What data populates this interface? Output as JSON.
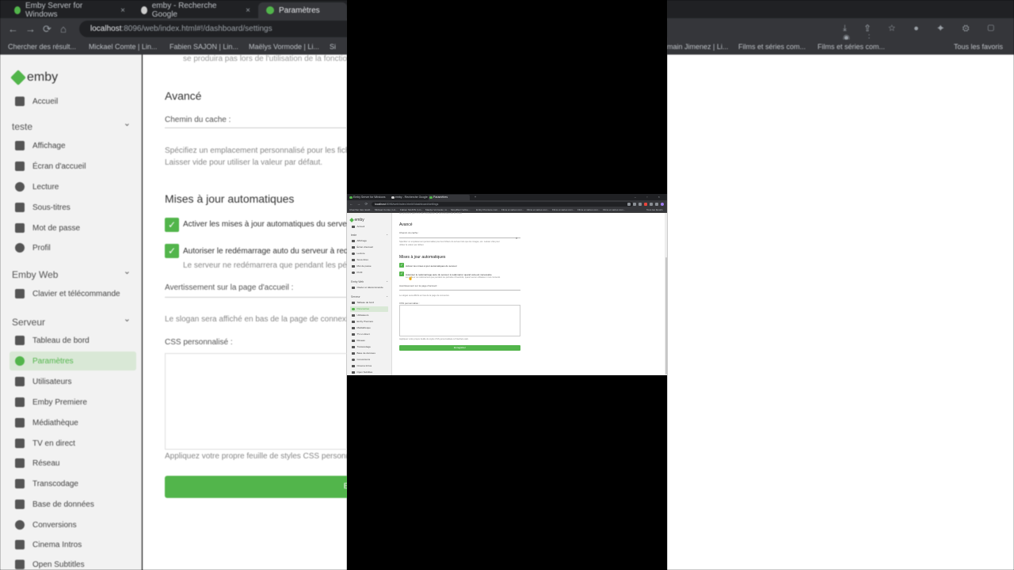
{
  "background": {
    "tabs": [
      {
        "label": "Emby Server for Windows",
        "close": "×"
      },
      {
        "label": "emby - Recherche Google",
        "close": "×"
      },
      {
        "label": "Paramètres",
        "close": "×"
      }
    ],
    "url_host": "localhost",
    "url_rest": ":8096/web/index.html#!/dashboard/settings",
    "bookmarks": [
      "Chercher des résult...",
      "Mickael Comte | Lin...",
      "Fabien SAJON | Lin...",
      "Maëlys Vormode | Li...",
      "Si"
    ],
    "bookmarks_right": [
      "main Jimenez | Li...",
      "Films et séries com...",
      "Films et séries com...",
      "Tous les favoris"
    ],
    "sidebar": {
      "logo": "emby",
      "home": "Accueil",
      "user_section": "teste",
      "user_items": [
        "Affichage",
        "Écran d'accueil",
        "Lecture",
        "Sous-titres",
        "Mot de passe",
        "Profil"
      ],
      "web_section": "Emby Web",
      "web_items": [
        "Clavier et télécommande"
      ],
      "server_section": "Serveur",
      "server_items": [
        "Tableau de bord",
        "Paramètres",
        "Utilisateurs",
        "Emby Premiere",
        "Médiathèque",
        "TV en direct",
        "Réseau",
        "Transcodage",
        "Base de données",
        "Conversions",
        "Cinema Intros",
        "Open Subtitles"
      ]
    },
    "main": {
      "faded_top": "se produira pas lors de l'utilisation de la fonction",
      "advanced_title": "Avancé",
      "cache_label": "Chemin du cache :",
      "cache_hint_1": "Spécifiez un emplacement personnalisé pour les fichi",
      "cache_hint_2": "Laisser vide pour utiliser la valeur par défaut.",
      "updates_title": "Mises à jour automatiques",
      "check1": "Activer les mises à jour automatiques du serveu",
      "check2": "Autoriser le redémarrage auto du serveur à redé",
      "check2_hint": "Le serveur ne redémarrera que pendant les pério",
      "warning_label": "Avertissement sur la page d'accueil :",
      "warning_hint": "Le slogan sera affiché en bas de la page de connexio",
      "css_label": "CSS personnalisé :",
      "css_hint": "Appliquez votre propre feuille de styles CSS personna",
      "save_partial": "En"
    }
  },
  "window": {
    "tabs": [
      {
        "label": "Emby Server for Windows",
        "close": "×"
      },
      {
        "label": "emby - Recherche Google",
        "close": "×"
      },
      {
        "label": "Paramètres",
        "close": "×"
      }
    ],
    "new_tab": "+",
    "window_controls": "– ▫ ×",
    "nav_glyphs": "← → ⟳ ⌂",
    "url_host": "localhost",
    "url_rest": ":8096/web/index.html#!/dashboard/settings",
    "bookmarks": [
      "Chercher des résult...",
      "Mickael Comte | Lin...",
      "Fabien SAJON | Lin...",
      "Maëlys Vormode | Li...",
      "Simplifiez l'arbre...",
      "Emby Premiere com...",
      "Films et séries com...",
      "Films et séries com...",
      "Films et séries com...",
      "Films et séries com...",
      "Films et séries com...",
      "Films et séries com..."
    ],
    "bookmarks_right": "Tous les favoris",
    "sidebar": {
      "logo": "emby",
      "home": "Accueil",
      "user_section": "teste",
      "user_items": [
        "Affichage",
        "Écran d'accueil",
        "Lecture",
        "Sous-titres",
        "Mot de passe",
        "Profil"
      ],
      "web_section": "Emby Web",
      "web_items": [
        "Clavier et télécommande"
      ],
      "server_section": "Serveur",
      "server_items": [
        "Tableau de bord",
        "Paramètres",
        "Utilisateurs",
        "Emby Premiere",
        "Médiathèque",
        "TV en direct",
        "Réseau",
        "Transcodage",
        "Base de données",
        "Conversions",
        "Cinema Intros",
        "Open Subtitles"
      ]
    },
    "content": {
      "faded_top": "se produira pas lors de l'utilisation de la fonction de la vidéo",
      "advanced_title": "Avancé",
      "cache_label": "Chemin du cache :",
      "cache_value": "",
      "cache_hint_1": "Spécifiez un emplacement personnalisé pour les fichiers du serveur tels que les images, etc. Laisser vide pour",
      "cache_hint_2": "utiliser la valeur par défaut.",
      "updates_title": "Mises à jour automatiques",
      "check1": "Activer les mises à jour automatiques du serveur",
      "check2": "Autoriser le redémarrage auto du serveur à redémarrer quand cela est nécessaire",
      "check2_hint": "Le serveur ne redémarrera que pendant les périodes d'inactivité, quand aucun utilisateur n'est connecté.",
      "warning_label": "Avertissement sur la page d'accueil :",
      "warning_value": "",
      "warning_hint": "Le slogan sera affiché en bas de la page de connexion.",
      "css_label": "CSS personnalisé :",
      "css_value": "",
      "css_hint": "Appliquez votre propre feuille de styles CSS personnalisée à l'interface web.",
      "save_label": "Enregistrer"
    }
  },
  "colors": {
    "accent": "#52b54b",
    "chrome_dark": "#202124",
    "chrome_mid": "#35363a"
  }
}
